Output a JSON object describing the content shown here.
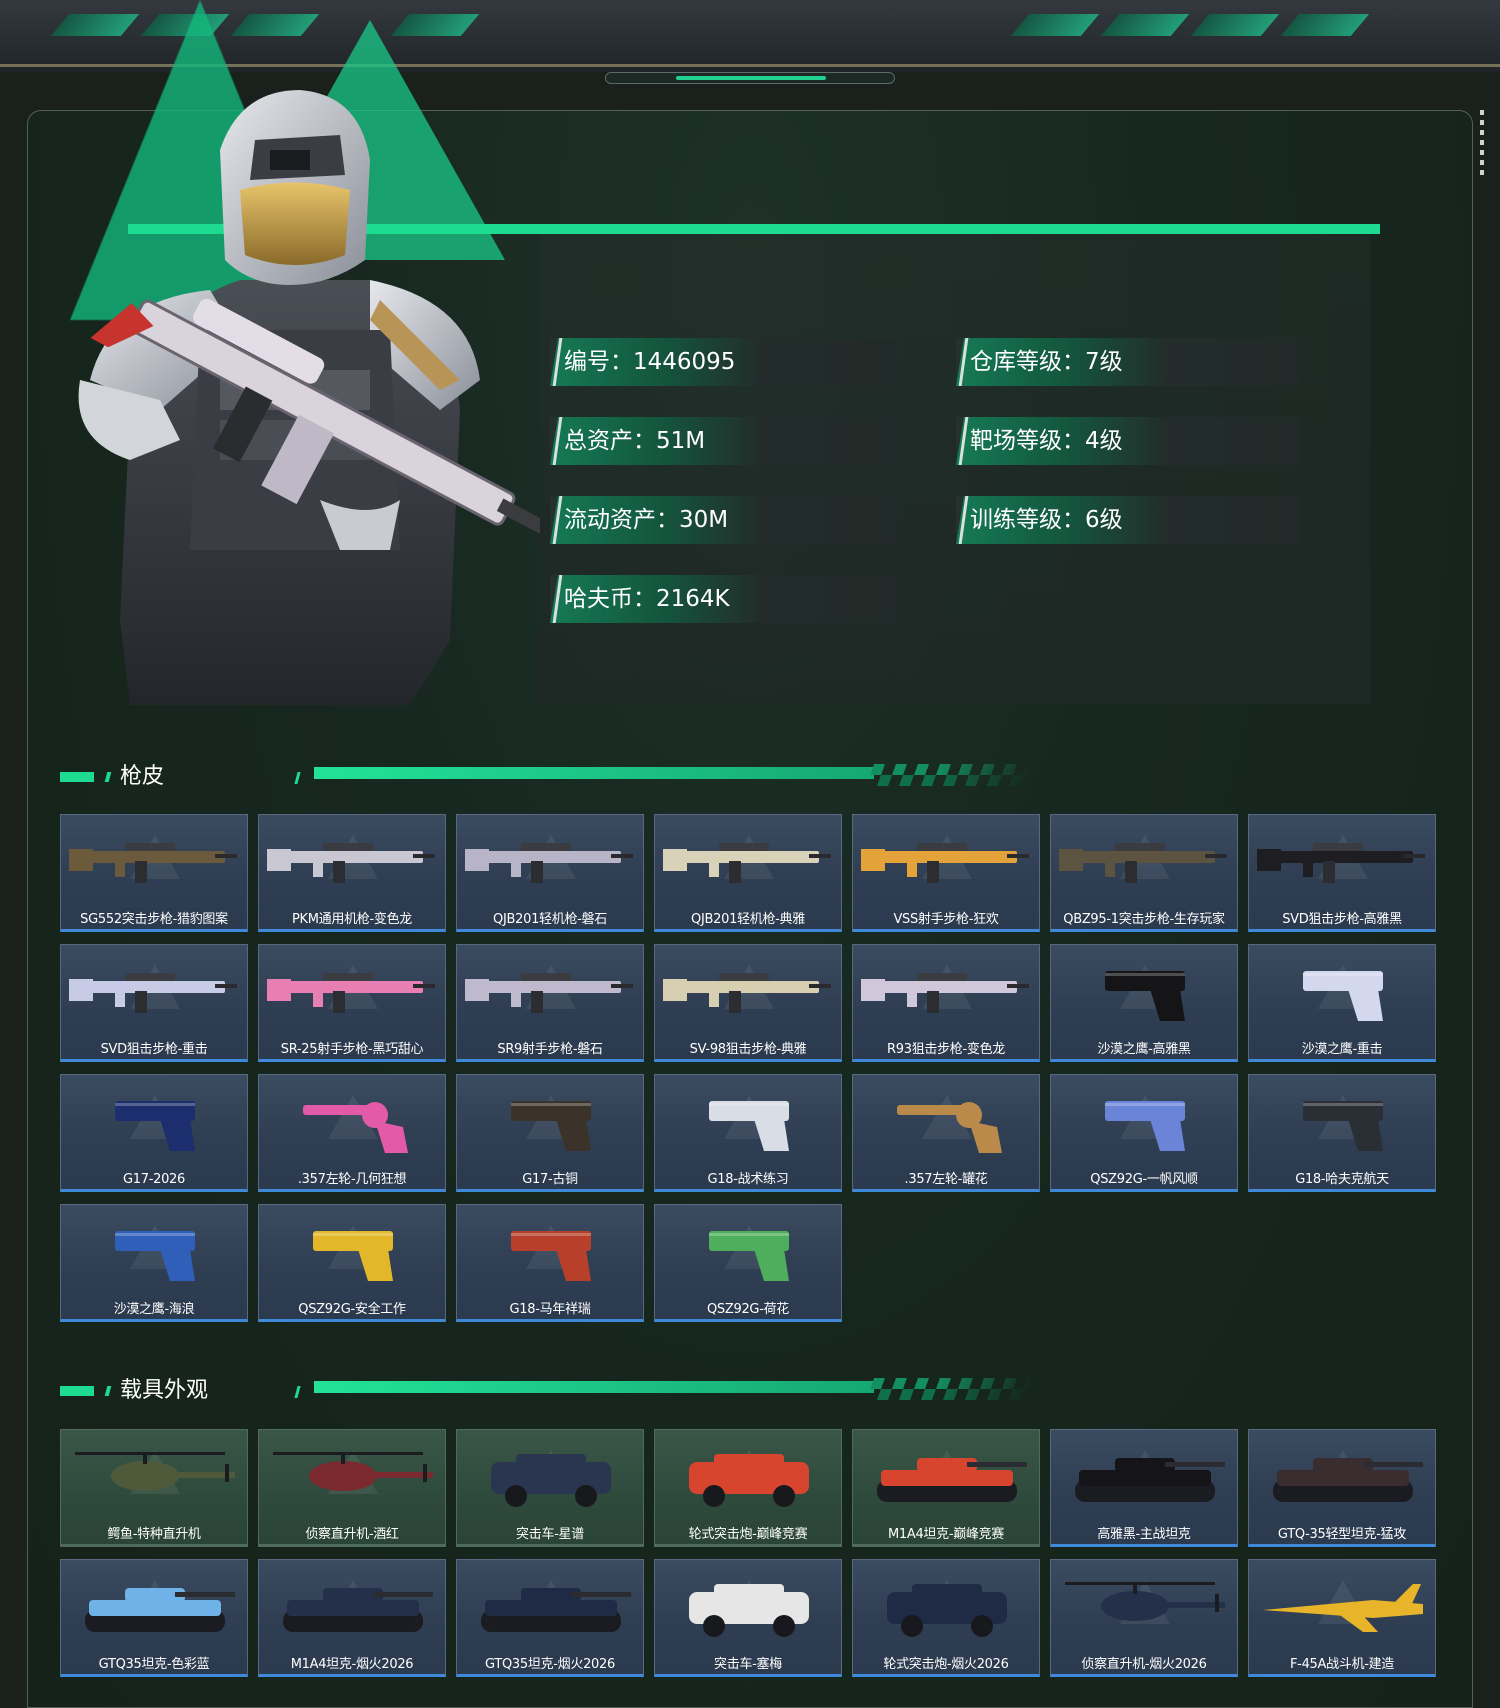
{
  "stats": {
    "left": [
      {
        "label": "编号：1446095"
      },
      {
        "label": "总资产：51M"
      },
      {
        "label": "流动资产：30M"
      },
      {
        "label": "哈夫币：2164K"
      }
    ],
    "right": [
      {
        "label": "仓库等级：7级"
      },
      {
        "label": "靶场等级：4级"
      },
      {
        "label": "训练等级：6级"
      }
    ]
  },
  "sections": {
    "skins": {
      "title": "枪皮"
    },
    "vehicles": {
      "title": "载具外观"
    }
  },
  "skins": [
    {
      "label": "SG552突击步枪-猎豹图案",
      "type": "rifle",
      "color": "#6b5a3c"
    },
    {
      "label": "PKM通用机枪-变色龙",
      "type": "rifle",
      "color": "#c9c7d2"
    },
    {
      "label": "QJB201轻机枪-磐石",
      "type": "rifle",
      "color": "#b8b4c8"
    },
    {
      "label": "QJB201轻机枪-典雅",
      "type": "rifle",
      "color": "#d8d2b8"
    },
    {
      "label": "VSS射手步枪-狂欢",
      "type": "rifle",
      "color": "#e4a23a"
    },
    {
      "label": "QBZ95-1突击步枪-生存玩家",
      "type": "rifle",
      "color": "#5c5340"
    },
    {
      "label": "SVD狙击步枪-高雅黑",
      "type": "rifle",
      "color": "#1e1e22"
    },
    {
      "label": "SVD狙击步枪-重击",
      "type": "rifle",
      "color": "#c8cbe6"
    },
    {
      "label": "SR-25射手步枪-黑巧甜心",
      "type": "rifle",
      "color": "#e77fb3"
    },
    {
      "label": "SR9射手步枪-磐石",
      "type": "rifle",
      "color": "#beb9cc"
    },
    {
      "label": "SV-98狙击步枪-典雅",
      "type": "rifle",
      "color": "#d6cfb0"
    },
    {
      "label": "R93狙击步枪-变色龙",
      "type": "rifle",
      "color": "#d0c8da"
    },
    {
      "label": "沙漠之鹰-高雅黑",
      "type": "pistol",
      "color": "#151518"
    },
    {
      "label": "沙漠之鹰-重击",
      "type": "pistol",
      "color": "#d4d8ee"
    },
    {
      "label": "G17-2026",
      "type": "pistol",
      "color": "#1d2e6e"
    },
    {
      "label": ".357左轮-几何狂想",
      "type": "revolver",
      "color": "#e35aa8"
    },
    {
      "label": "G17-古铜",
      "type": "pistol",
      "color": "#3b3329"
    },
    {
      "label": "G18-战术练习",
      "type": "pistol",
      "color": "#d9dde6"
    },
    {
      "label": ".357左轮-罐花",
      "type": "revolver",
      "color": "#b98a4a"
    },
    {
      "label": "QSZ92G-一帆风顺",
      "type": "pistol",
      "color": "#6a85d8"
    },
    {
      "label": "G18-哈夫克航天",
      "type": "pistol",
      "color": "#2a2f36"
    },
    {
      "label": "沙漠之鹰-海浪",
      "type": "pistol",
      "color": "#2f5fb8"
    },
    {
      "label": "QSZ92G-安全工作",
      "type": "pistol",
      "color": "#e2b82a"
    },
    {
      "label": "G18-马年祥瑞",
      "type": "pistol",
      "color": "#b8402a"
    },
    {
      "label": "QSZ92G-荷花",
      "type": "pistol",
      "color": "#4fae5c"
    }
  ],
  "vehicles": [
    {
      "label": "鳄鱼-特种直升机",
      "type": "heli",
      "color": "#4f5a3a",
      "green": true
    },
    {
      "label": "侦察直升机-酒红",
      "type": "heli",
      "color": "#7a2a2e",
      "green": true
    },
    {
      "label": "突击车-星谱",
      "type": "car",
      "color": "#2a3550",
      "green": true
    },
    {
      "label": "轮式突击炮-巅峰竞赛",
      "type": "car",
      "color": "#d8452e",
      "green": true
    },
    {
      "label": "M1A4坦克-巅峰竞赛",
      "type": "tank",
      "color": "#d8452e",
      "green": true
    },
    {
      "label": "高雅黑-主战坦克",
      "type": "tank",
      "color": "#151519",
      "green": false
    },
    {
      "label": "GTQ-35轻型坦克-猛攻",
      "type": "tank",
      "color": "#3a2d30",
      "green": false
    },
    {
      "label": "GTQ35坦克-色彩蓝",
      "type": "tank",
      "color": "#6fb2e8",
      "green": false
    },
    {
      "label": "M1A4坦克-烟火2026",
      "type": "tank",
      "color": "#24304a",
      "green": false
    },
    {
      "label": "GTQ35坦克-烟火2026",
      "type": "tank",
      "color": "#1f2a44",
      "green": false
    },
    {
      "label": "突击车-塞梅",
      "type": "car",
      "color": "#e6e6e6",
      "green": false
    },
    {
      "label": "轮式突击炮-烟火2026",
      "type": "car",
      "color": "#1f2a44",
      "green": false
    },
    {
      "label": "侦察直升机-烟火2026",
      "type": "heli",
      "color": "#24304a",
      "green": false
    },
    {
      "label": "F-45A战斗机-建造",
      "type": "jet",
      "color": "#e8b52a",
      "green": false
    }
  ],
  "colors": {
    "accent": "#1edb92",
    "card_blue_edge": "#3f8ad8",
    "card_green_edge": "#29cc8a"
  }
}
